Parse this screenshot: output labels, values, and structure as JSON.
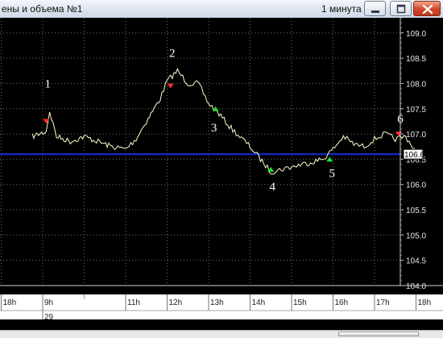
{
  "window": {
    "title": "ены и объема №1",
    "interval": "1 минута"
  },
  "colors": {
    "background": "#000000",
    "price_line": "#ffffcc",
    "level_line": "#1a2bd6",
    "sell_marker": "#ff2a2a",
    "buy_marker": "#22dd33",
    "annotation": "#ffffff"
  },
  "chart_data": {
    "type": "line",
    "ylim": [
      104.0,
      109.3
    ],
    "y_ticks": [
      "109.0",
      "108.5",
      "108.0",
      "107.5",
      "107.0",
      "106.5",
      "106.0",
      "105.5",
      "105.0",
      "104.5",
      "104.0"
    ],
    "x_ticks": [
      "18h",
      "9h",
      "11h",
      "12h",
      "13h",
      "14h",
      "15h",
      "16h",
      "17h",
      "18h"
    ],
    "date_label": "29",
    "current_price": "106.6",
    "level": 106.6,
    "series": [
      {
        "x": [
          "8h45",
          "9h05",
          "9h10",
          "9h20",
          "9h40",
          "10h00",
          "10h20",
          "10h40",
          "11h00",
          "11h15",
          "11h30",
          "11h50",
          "12h00",
          "12h15",
          "12h30",
          "12h45",
          "13h00",
          "13h15",
          "13h30",
          "13h45",
          "14h00",
          "14h15",
          "14h30",
          "14h45",
          "15h00",
          "15h15",
          "15h30",
          "15h45",
          "16h00",
          "16h15",
          "16h30",
          "16h45",
          "17h00",
          "17h15",
          "17h30",
          "17h45",
          "18h00"
        ],
        "values": [
          106.95,
          107.05,
          107.45,
          106.95,
          106.85,
          106.95,
          106.85,
          106.75,
          106.7,
          106.9,
          107.25,
          107.7,
          108.05,
          108.25,
          108.0,
          108.0,
          107.6,
          107.4,
          107.15,
          106.95,
          106.75,
          106.5,
          106.25,
          106.3,
          106.35,
          106.4,
          106.45,
          106.5,
          106.7,
          106.95,
          106.8,
          106.75,
          106.9,
          107.0,
          106.9,
          106.95,
          106.65
        ]
      }
    ],
    "markers": [
      {
        "label": "1",
        "x": "9h05",
        "y": 107.25,
        "type": "sell"
      },
      {
        "label": "2",
        "x": "12h05",
        "y": 107.95,
        "type": "sell"
      },
      {
        "label": "3",
        "x": "13h10",
        "y": 107.5,
        "type": "buy"
      },
      {
        "label": "4",
        "x": "14h30",
        "y": 106.3,
        "type": "buy"
      },
      {
        "label": "5",
        "x": "15h55",
        "y": 106.5,
        "type": "buy"
      },
      {
        "label": "6",
        "x": "17h35",
        "y": 107.0,
        "type": "sell"
      }
    ]
  }
}
